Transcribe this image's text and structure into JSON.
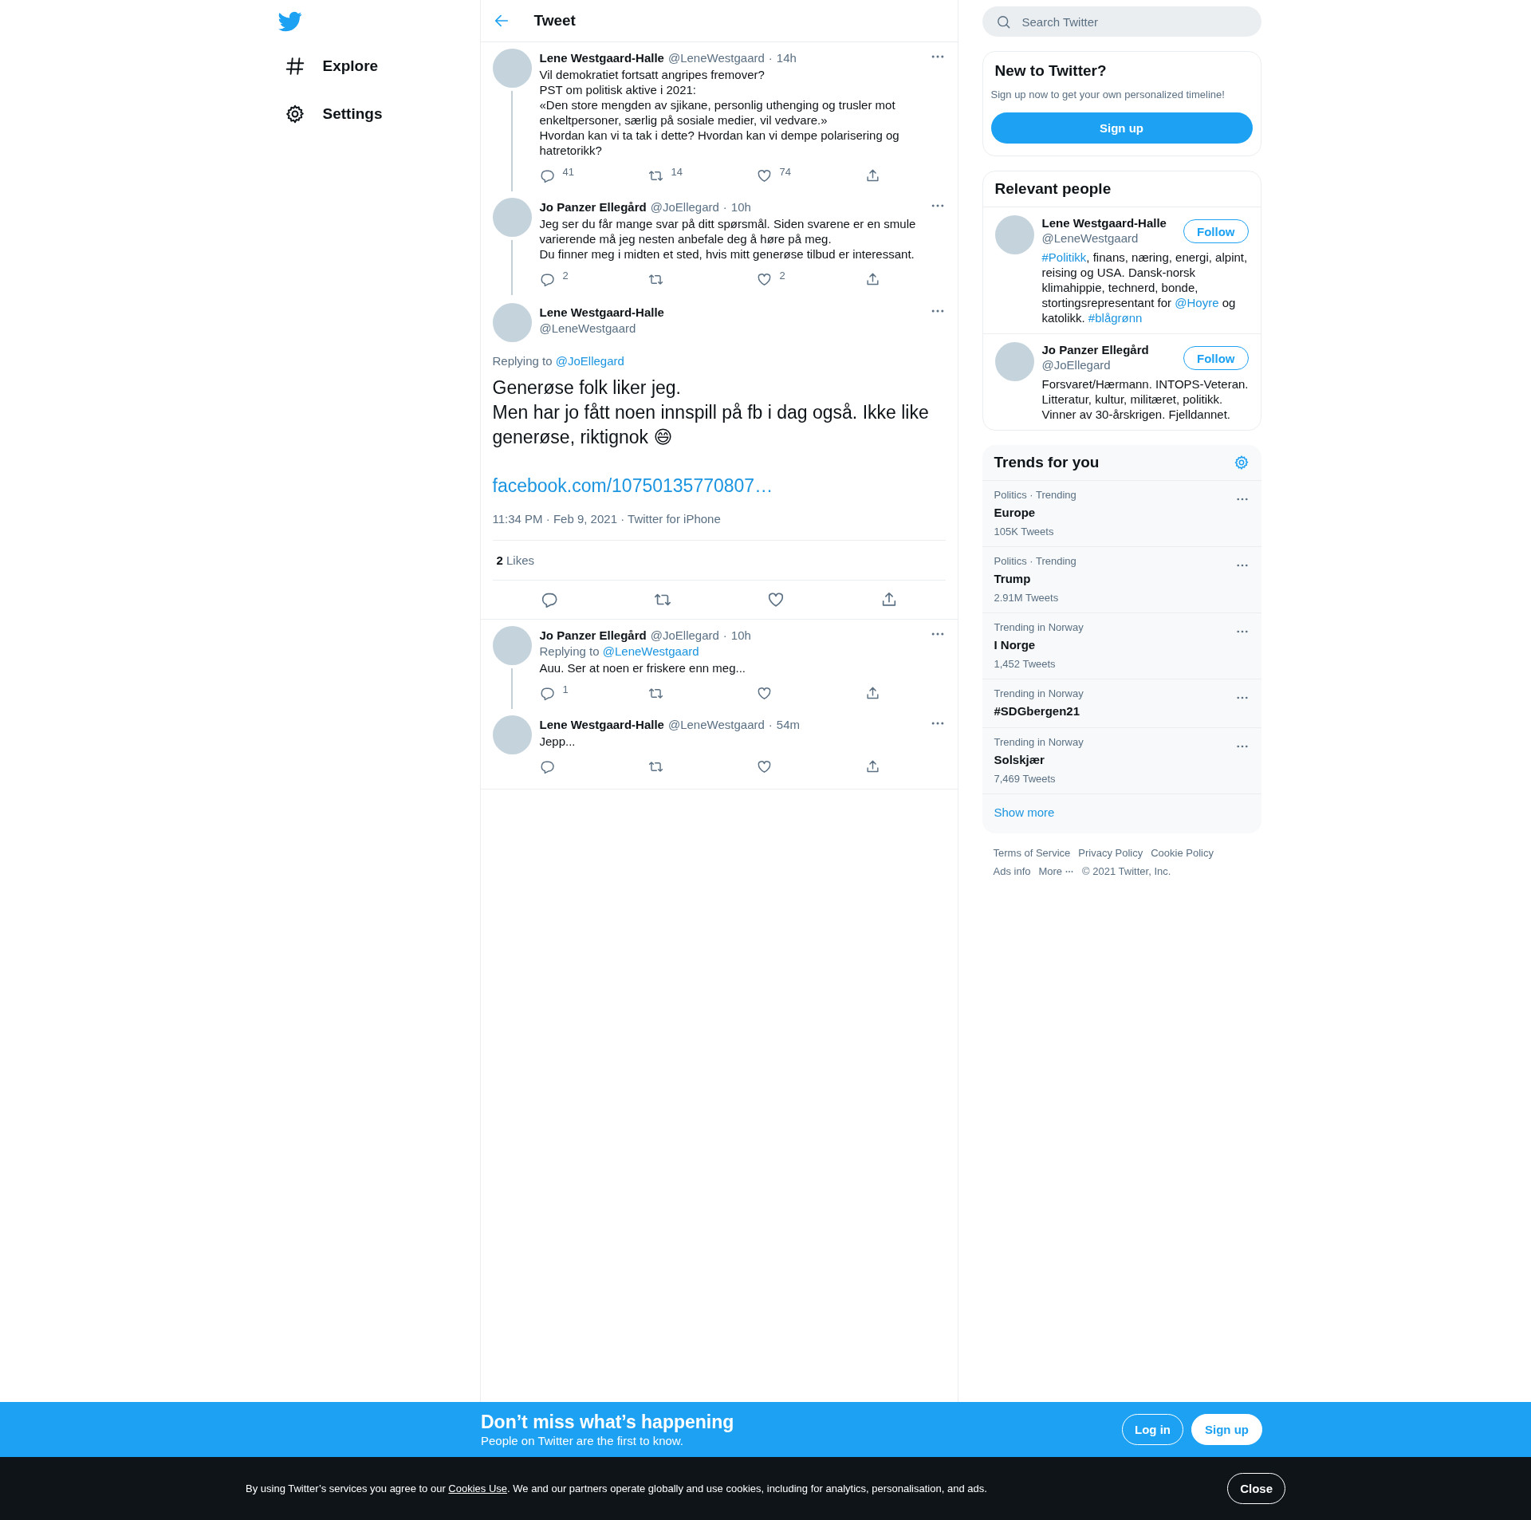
{
  "nav": {
    "items": [
      {
        "label": "Explore",
        "kind": "hashtag"
      },
      {
        "label": "Settings",
        "kind": "gear"
      }
    ]
  },
  "header": {
    "title": "Tweet"
  },
  "tweets": [
    {
      "kind": "thread",
      "author": "Lene Westgaard-Halle",
      "handle": "@LeneWestgaard",
      "separator": "·",
      "time": "14h",
      "text": "Vil demokratiet fortsatt angripes fremover?\nPST om politisk aktive i 2021:\n«Den store mengden av sjikane, personlig uthenging og trusler mot enkeltpersoner, særlig på sosiale medier, vil vedvare.»\nHvordan kan vi ta tak i dette? Hvordan kan vi dempe polarisering og hatretorikk?",
      "replies": "41",
      "retweets": "14",
      "likes": "74",
      "thread_below": true
    },
    {
      "kind": "thread",
      "author": "Jo Panzer Ellegård",
      "handle": "@JoEllegard",
      "separator": "·",
      "time": "10h",
      "text": "Jeg ser du får mange svar på ditt spørsmål. Siden svarene er en smule varierende må jeg nesten anbefale deg å høre på meg.\nDu finner meg i midten et sted, hvis mitt generøse tilbud er interessant.",
      "replies": "2",
      "likes": "2",
      "thread_below": true
    },
    {
      "kind": "focus",
      "author": "Lene Westgaard-Halle",
      "handle": "@LeneWestgaard",
      "reply_label": "Replying to ",
      "reply_to": "@JoEllegard",
      "text": "Generøse folk liker jeg.\nMen har jo fått noen innspill på fb i dag også. Ikke like generøse, riktignok 😄",
      "link": "facebook.com/10750135770807…",
      "meta": "11:34 PM · Feb 9, 2021 · Twitter for iPhone",
      "likes_summary": "**2** Likes"
    },
    {
      "kind": "thread",
      "author": "Jo Panzer Ellegård",
      "handle": "@JoEllegard",
      "separator": "·",
      "time": "10h",
      "reply_label": "Replying to ",
      "reply_to": "@LeneWestgaard",
      "text": "Auu. Ser at noen er friskere enn meg...",
      "replies": "1",
      "thread_below": true
    },
    {
      "kind": "thread",
      "author": "Lene Westgaard-Halle",
      "handle": "@LeneWestgaard",
      "separator": "·",
      "time": "54m",
      "text": "Jepp...",
      "thread_below": false
    }
  ],
  "search": {
    "placeholder": "Search Twitter"
  },
  "signup_card": {
    "title": "New to Twitter?",
    "subtitle": "Sign up now to get your own personalized timeline!",
    "button": "Sign up"
  },
  "relevant_people": {
    "title": "Relevant people",
    "people": [
      {
        "name": "Lene Westgaard-Halle",
        "handle": "@LeneWestgaard",
        "button": "Follow",
        "bio": [
          {
            "text": "#Politikk",
            "link": true
          },
          {
            "text": ", finans, næring, energi, alpint, reising og USA. Dansk-norsk klimahippie, technerd, bonde, stortingsrepresentant for "
          },
          {
            "text": "@Hoyre",
            "link": true
          },
          {
            "text": " og katolikk. "
          },
          {
            "text": "#blågrønn",
            "link": true
          }
        ]
      },
      {
        "name": "Jo Panzer Ellegård",
        "handle": "@JoEllegard",
        "button": "Follow",
        "bio": [
          {
            "text": "Forsvaret/Hærmann. INTOPS-Veteran. Litteratur, kultur, militæret, politikk. Vinner av 30-årskrigen. Fjelldannet."
          }
        ]
      }
    ]
  },
  "trends": {
    "title": "Trends for you",
    "items": [
      {
        "context": "Politics · Trending",
        "name": "Europe",
        "count": "105K Tweets"
      },
      {
        "context": "Politics · Trending",
        "name": "Trump",
        "count": "2.91M Tweets"
      },
      {
        "context": "Trending in Norway",
        "name": "I Norge",
        "count": "1,452 Tweets"
      },
      {
        "context": "Trending in Norway",
        "name": "#SDGbergen21"
      },
      {
        "context": "Trending in Norway",
        "name": "Solskjær",
        "count": "7,469 Tweets"
      }
    ],
    "show_more": "Show more"
  },
  "footer": {
    "links": [
      {
        "label": "Terms of Service",
        "kind": "link"
      },
      {
        "label": "Privacy Policy",
        "kind": "link"
      },
      {
        "label": "Cookie Policy",
        "kind": "link"
      },
      {
        "label": "Ads info",
        "kind": "link"
      },
      {
        "label": "More",
        "kind": "menu"
      }
    ],
    "copyright": "© 2021 Twitter, Inc."
  },
  "banner": {
    "title": "Don’t miss what’s happening",
    "subtitle": "People on Twitter are the first to know.",
    "buttons": [
      {
        "label": "Log in",
        "kind": "outline"
      },
      {
        "label": "Sign up",
        "kind": "filled"
      }
    ]
  },
  "cookie_bar": {
    "text": [
      {
        "text": "By using Twitter’s services you agree to our "
      },
      {
        "text": "Cookies Use",
        "link": true
      },
      {
        "text": ". We and our partners operate globally and use cookies, including for analytics, personalisation, and ads."
      }
    ],
    "button": "Close"
  }
}
